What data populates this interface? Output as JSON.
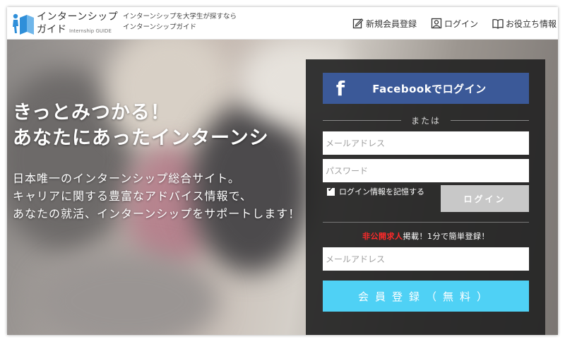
{
  "header": {
    "logo_title": "インターンシップ",
    "logo_sub": "ガイド",
    "logo_sub_en": "Internship GUIDE",
    "tagline_line1": "インターンシップを大学生が探すなら",
    "tagline_line2": "インターンシップガイド",
    "nav": [
      {
        "label": "新規会員登録",
        "icon": "register-icon"
      },
      {
        "label": "ログイン",
        "icon": "login-icon"
      },
      {
        "label": "お役立ち情報",
        "icon": "book-icon"
      }
    ]
  },
  "hero": {
    "title_line1": "きっとみつかる！",
    "title_line2": "あなたにあったインターンシ",
    "desc_line1": "日本唯一のインターンシップ総合サイト。",
    "desc_line2": "キャリアに関する豊富なアドバイス情報で、",
    "desc_line3": "あなたの就活、インターンシップをサポートします！"
  },
  "login_panel": {
    "facebook_label": "Facebookでログイン",
    "facebook_icon": "facebook-icon",
    "divider_text": "または",
    "email_placeholder": "メールアドレス",
    "password_placeholder": "パスワード",
    "remember_label": "ログイン情報を記憶する",
    "remember_checked": true,
    "login_button": "ログイン",
    "promo_highlight": "非公開求人",
    "promo_rest": "掲載！1分で簡単登録！",
    "register_email_placeholder": "メールアドレス",
    "register_button": "会員登録（無料）"
  },
  "colors": {
    "facebook": "#3b5998",
    "register": "#4fd1f5",
    "promo_highlight": "#ff2a2a",
    "login_button": "#c8c8c8",
    "panel": "#242424",
    "logo": "#2f8fd9"
  }
}
